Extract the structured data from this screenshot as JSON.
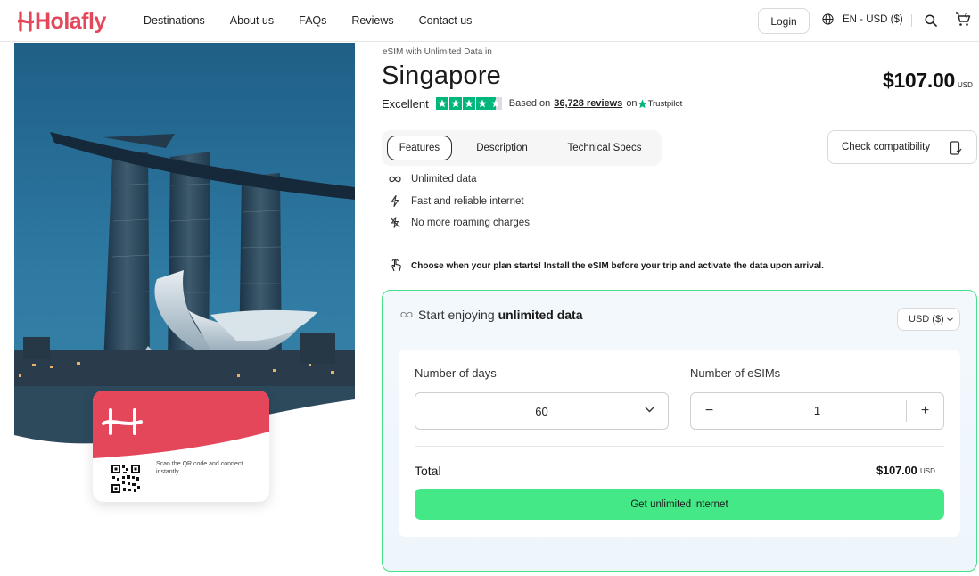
{
  "nav": {
    "logo_text": "Holafly",
    "links": [
      "Destinations",
      "About us",
      "FAQs",
      "Reviews",
      "Contact us"
    ],
    "login_label": "Login",
    "language_label": "EN - USD ($)",
    "icons": {
      "language": "globe-icon",
      "search": "search-icon",
      "cart": "cart-icon"
    }
  },
  "hero": {
    "image_subject": "Marina Bay Sands and ArtScience Museum at dusk",
    "card": {
      "qr_text": "Scan the QR code and connect instantly."
    }
  },
  "product": {
    "eyebrow": "eSIM with Unlimited Data in",
    "title": "Singapore",
    "price": "$107.00",
    "price_unit": "USD"
  },
  "rating": {
    "label": "Excellent",
    "stars": 4.5,
    "based_on": "Based on",
    "reviews_count": "36,728 reviews",
    "on": "on",
    "provider": "Trustpilot"
  },
  "tabs": [
    {
      "label": "Features",
      "active": true
    },
    {
      "label": "Description",
      "active": false
    },
    {
      "label": "Technical Specs",
      "active": false
    }
  ],
  "check_compatibility": "Check compatibility",
  "features": [
    {
      "icon": "infinity-icon",
      "label": "Unlimited data"
    },
    {
      "icon": "lightning-icon",
      "label": "Fast and reliable internet"
    },
    {
      "icon": "no-roaming-icon",
      "label": "No more roaming charges"
    }
  ],
  "choose_note": "Choose when your plan starts! Install the eSIM before your trip and activate the data upon arrival.",
  "plan": {
    "heading_prefix": "Start enjoying",
    "heading_bold": "unlimited data",
    "currency_select": "USD ($)",
    "days_label": "Number of days",
    "days_value": "60",
    "esims_label": "Number of eSIMs",
    "esims_value": "1",
    "minus": "−",
    "plus": "+",
    "total_label": "Total",
    "total_value": "$107.00",
    "total_unit": "USD",
    "cta_label": "Get unlimited internet"
  },
  "colors": {
    "brand": "#e5475a",
    "cta": "#45e887",
    "trustpilot": "#00b67a",
    "plan_border": "#45e087"
  }
}
